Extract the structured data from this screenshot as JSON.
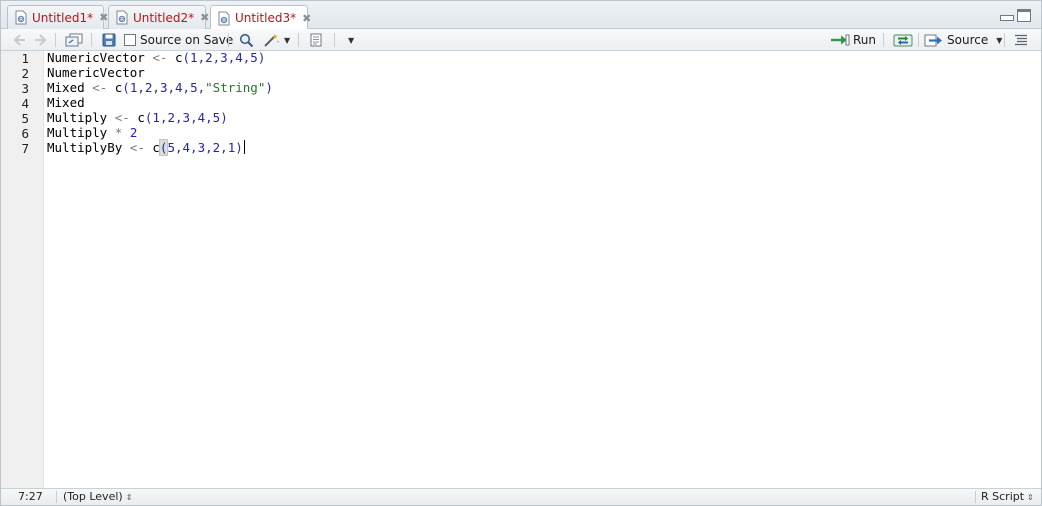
{
  "tabs": [
    {
      "label": "Untitled1*",
      "active": false
    },
    {
      "label": "Untitled2*",
      "active": false
    },
    {
      "label": "Untitled3*",
      "active": true
    }
  ],
  "toolbar": {
    "source_on_save": "Source on Save",
    "run": "Run",
    "source": "Source"
  },
  "editor": {
    "line_numbers": [
      "1",
      "2",
      "3",
      "4",
      "5",
      "6",
      "7"
    ],
    "lines": [
      "NumericVector <- c(1,2,3,4,5)",
      "NumericVector",
      "Mixed <- c(1,2,3,4,5,\"String\")",
      "Mixed",
      "Multiply <- c(1,2,3,4,5)",
      "Multiply * 2",
      "MultiplyBy <- c(5,4,3,2,1)"
    ]
  },
  "status": {
    "cursor_position": "7:27",
    "scope": "(Top Level)",
    "file_type": "R Script"
  },
  "colors": {
    "tab_text": "#b8141c",
    "number": "#2222bb",
    "string": "#237a23",
    "operator": "#7a7a7a"
  }
}
